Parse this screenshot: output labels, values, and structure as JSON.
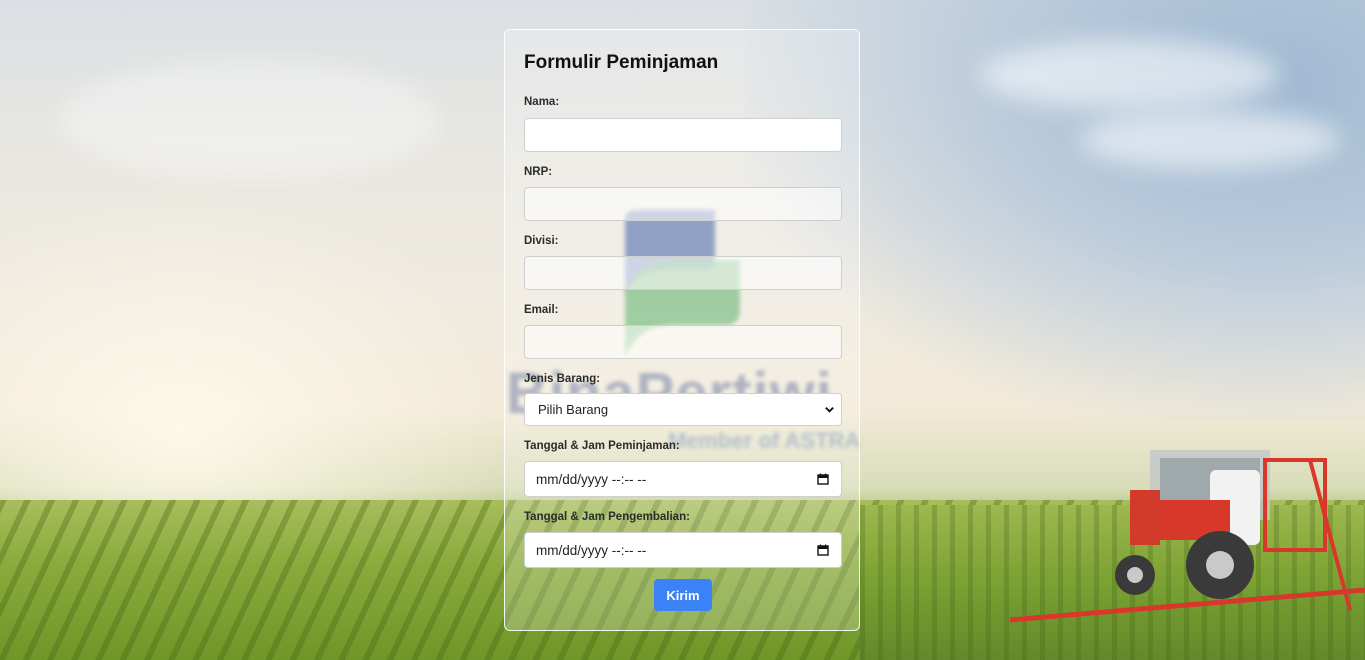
{
  "form": {
    "title": "Formulir Peminjaman",
    "fields": {
      "nama": {
        "label": "Nama:",
        "value": ""
      },
      "nrp": {
        "label": "NRP:",
        "value": ""
      },
      "divisi": {
        "label": "Divisi:",
        "value": ""
      },
      "email": {
        "label": "Email:",
        "value": ""
      },
      "jenis_barang": {
        "label": "Jenis Barang:",
        "selected": "Pilih Barang"
      },
      "tanggal_peminjaman": {
        "label": "Tanggal & Jam Peminjaman:",
        "placeholder": "mm/dd/yyyy --:-- --"
      },
      "tanggal_pengembalian": {
        "label": "Tanggal & Jam Pengembalian:",
        "placeholder": "mm/dd/yyyy --:-- --"
      }
    },
    "submit_label": "Kirim"
  },
  "background": {
    "watermark_text": "BinaPertiwi",
    "watermark_sub": "Member of ASTRA"
  },
  "colors": {
    "accent": "#3b82f6",
    "logo_blue": "#2f4f9e",
    "logo_green": "#3fa34d"
  }
}
